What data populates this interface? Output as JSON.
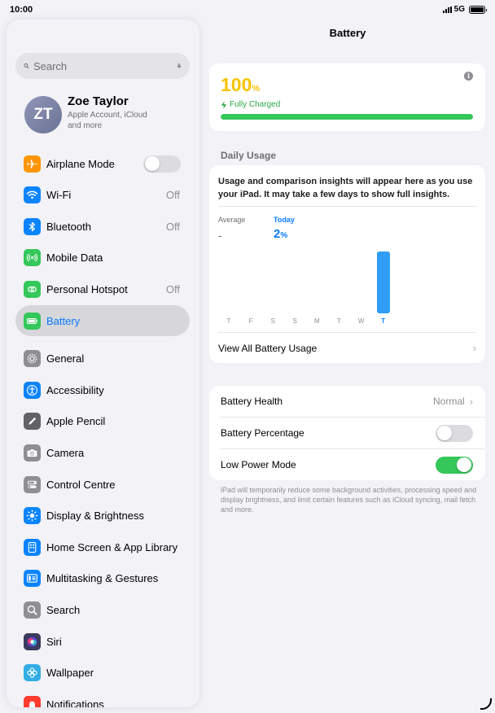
{
  "status": {
    "time": "10:00",
    "network": "5G"
  },
  "sidebar": {
    "search": {
      "placeholder": "Search"
    },
    "profile": {
      "initials": "ZT",
      "name": "Zoe Taylor",
      "subtitle": "Apple Account, iCloud and more"
    },
    "items": [
      {
        "label": "Airplane Mode",
        "icon": "airplane-icon",
        "color": "#ff9500",
        "toggle": false
      },
      {
        "label": "Wi-Fi",
        "icon": "wifi-icon",
        "color": "#0a84ff",
        "value": "Off"
      },
      {
        "label": "Bluetooth",
        "icon": "bluetooth-icon",
        "color": "#0a84ff",
        "value": "Off"
      },
      {
        "label": "Mobile Data",
        "icon": "antenna-icon",
        "color": "#34c759"
      },
      {
        "label": "Personal Hotspot",
        "icon": "hotspot-icon",
        "color": "#34c759",
        "value": "Off"
      },
      {
        "label": "Battery",
        "icon": "battery-icon",
        "color": "#34c759",
        "selected": true
      },
      {
        "label": "General",
        "icon": "gear-icon",
        "color": "#8e8e93"
      },
      {
        "label": "Accessibility",
        "icon": "accessibility-icon",
        "color": "#0a84ff"
      },
      {
        "label": "Apple Pencil",
        "icon": "pencil-icon",
        "color": "#636366"
      },
      {
        "label": "Camera",
        "icon": "camera-icon",
        "color": "#8e8e93"
      },
      {
        "label": "Control Centre",
        "icon": "control-centre-icon",
        "color": "#8e8e93"
      },
      {
        "label": "Display & Brightness",
        "icon": "sun-icon",
        "color": "#0a84ff"
      },
      {
        "label": "Home Screen & App Library",
        "icon": "home-screen-icon",
        "color": "#0a84ff"
      },
      {
        "label": "Multitasking & Gestures",
        "icon": "multitasking-icon",
        "color": "#0a84ff"
      },
      {
        "label": "Search",
        "icon": "search-icon",
        "color": "#8e8e93"
      },
      {
        "label": "Siri",
        "icon": "siri-icon",
        "color": "#3a3a5e"
      },
      {
        "label": "Wallpaper",
        "icon": "flower-icon",
        "color": "#32ade6"
      },
      {
        "label": "Notifications",
        "icon": "bell-icon",
        "color": "#ff3b30"
      }
    ]
  },
  "main": {
    "title": "Battery",
    "level": {
      "number": "100",
      "sign": "%",
      "status": "Fully Charged",
      "fraction": 1.0,
      "color": "#f5c400"
    },
    "daily_usage": {
      "header": "Daily Usage",
      "message": "Usage and comparison insights will appear here as you use your iPad. It may take a few days to show full insights.",
      "average_label": "Average",
      "average_value": "-",
      "today_label": "Today",
      "today_value": "2",
      "today_sign": "%",
      "view_all": "View All Battery Usage"
    },
    "battery_health": {
      "label": "Battery Health",
      "value": "Normal"
    },
    "battery_percentage": {
      "label": "Battery Percentage",
      "on": false
    },
    "low_power": {
      "label": "Low Power Mode",
      "on": true
    },
    "footnote": "iPad will temporarily reduce some background activities, processing speed and display brightness, and limit certain features such as iCloud syncing, mail fetch and more."
  },
  "chart_data": {
    "type": "bar",
    "categories": [
      "T",
      "F",
      "S",
      "S",
      "M",
      "T",
      "W",
      "T"
    ],
    "values": [
      0,
      0,
      0,
      0,
      0,
      0,
      0,
      2
    ],
    "highlight_index": 7
  }
}
